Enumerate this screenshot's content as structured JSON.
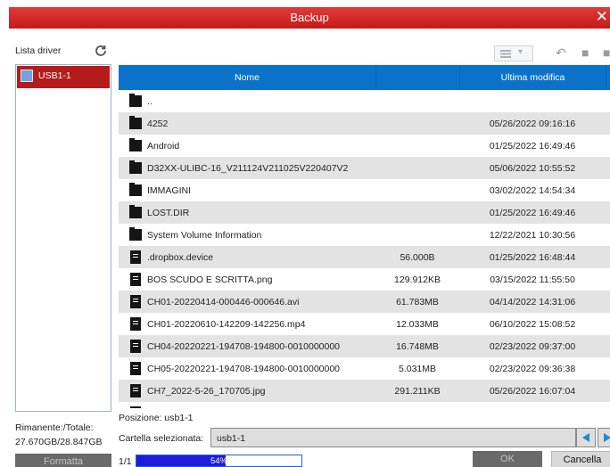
{
  "window": {
    "title": "Backup",
    "close_glyph": "✕"
  },
  "drives": {
    "label": "Lista driver",
    "items": [
      {
        "label": "USB1-1",
        "icon": "usb-icon"
      }
    ],
    "remaining_label": "Rimanente:/Totale:",
    "remaining_value": "27.670GB/28.847GB",
    "format_label": "Formatta"
  },
  "toolbar": {
    "view_icon": "list-view-icon",
    "icons": [
      "back-icon",
      "copy-icon",
      "delete-icon"
    ]
  },
  "table": {
    "headers": {
      "name": "Nome",
      "size": "",
      "modified": "Ultima modifica"
    },
    "rows": [
      {
        "type": "folder",
        "name": "..",
        "size": "",
        "modified": ""
      },
      {
        "type": "folder",
        "name": "4252",
        "size": "",
        "modified": "05/26/2022 09:16:16"
      },
      {
        "type": "folder",
        "name": "Android",
        "size": "",
        "modified": "01/25/2022 16:49:46"
      },
      {
        "type": "folder",
        "name": "D32XX-ULIBC-16_V211124V211025V220407V2",
        "size": "",
        "modified": "05/06/2022 10:55:52"
      },
      {
        "type": "folder",
        "name": "IMMAGINI",
        "size": "",
        "modified": "03/02/2022 14:54:34"
      },
      {
        "type": "folder",
        "name": "LOST.DIR",
        "size": "",
        "modified": "01/25/2022 16:49:46"
      },
      {
        "type": "folder",
        "name": "System Volume Information",
        "size": "",
        "modified": "12/22/2021 10:30:56"
      },
      {
        "type": "file",
        "name": ".dropbox.device",
        "size": "56.000B",
        "modified": "01/25/2022 16:48:44"
      },
      {
        "type": "file",
        "name": "BOS SCUDO E SCRITTA.png",
        "size": "129.912KB",
        "modified": "03/15/2022 11:55:50"
      },
      {
        "type": "file",
        "name": "CH01-20220414-000446-000646.avi",
        "size": "61.783MB",
        "modified": "04/14/2022 14:31:06"
      },
      {
        "type": "file",
        "name": "CH01-20220610-142209-142256.mp4",
        "size": "12.033MB",
        "modified": "06/10/2022 15:08:52"
      },
      {
        "type": "file",
        "name": "CH04-20220221-194708-194800-0010000000",
        "size": "16.748MB",
        "modified": "02/23/2022 09:37:00"
      },
      {
        "type": "file",
        "name": "CH05-20220221-194708-194800-0010000000",
        "size": "5.031MB",
        "modified": "02/23/2022 09:36:38"
      },
      {
        "type": "file",
        "name": "CH7_2022-5-26_170705.jpg",
        "size": "291.211KB",
        "modified": "05/26/2022 16:07:04"
      },
      {
        "type": "file",
        "name": "",
        "size": "",
        "modified": ""
      }
    ]
  },
  "footer": {
    "position_text": "Posizione: usb1-1",
    "selected_label": "Cartella selezionata:",
    "selected_value": "usb1-1",
    "page": "1/1",
    "progress_percent": 54,
    "progress_text": "54%",
    "ok_label": "OK",
    "cancel_label": "Cancella"
  }
}
